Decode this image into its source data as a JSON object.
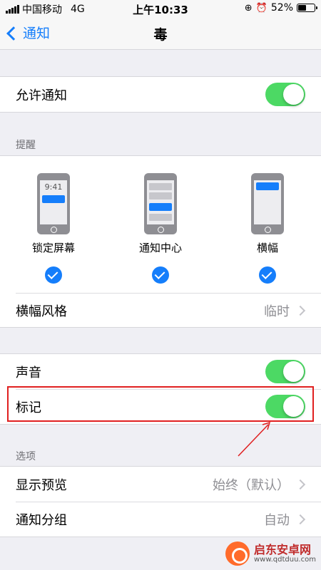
{
  "status_bar": {
    "carrier": "中国移动",
    "network": "4G",
    "time": "上午10:33",
    "battery_percent": "52%",
    "battery_level": 0.52
  },
  "nav": {
    "back_label": "通知",
    "title": "毒"
  },
  "allow_notifications": {
    "label": "允许通知",
    "on": true
  },
  "alerts_section": {
    "header": "提醒",
    "options": [
      {
        "label": "锁定屏幕",
        "checked": true,
        "preview_time": "9:41"
      },
      {
        "label": "通知中心",
        "checked": true
      },
      {
        "label": "横幅",
        "checked": true
      }
    ],
    "banner_style": {
      "label": "横幅风格",
      "value": "临时"
    }
  },
  "sounds": {
    "label": "声音",
    "on": true
  },
  "badges": {
    "label": "标记",
    "on": true
  },
  "options_section": {
    "header": "选项",
    "rows": [
      {
        "label": "显示预览",
        "value": "始终（默认）"
      },
      {
        "label": "通知分组",
        "value": "自动"
      }
    ]
  },
  "watermark": {
    "name": "启东安卓网",
    "url": "www.qdtduu.com"
  },
  "colors": {
    "accent": "#157efb",
    "toggle_on": "#4cd964",
    "highlight": "#e02020",
    "background": "#efeff4"
  }
}
